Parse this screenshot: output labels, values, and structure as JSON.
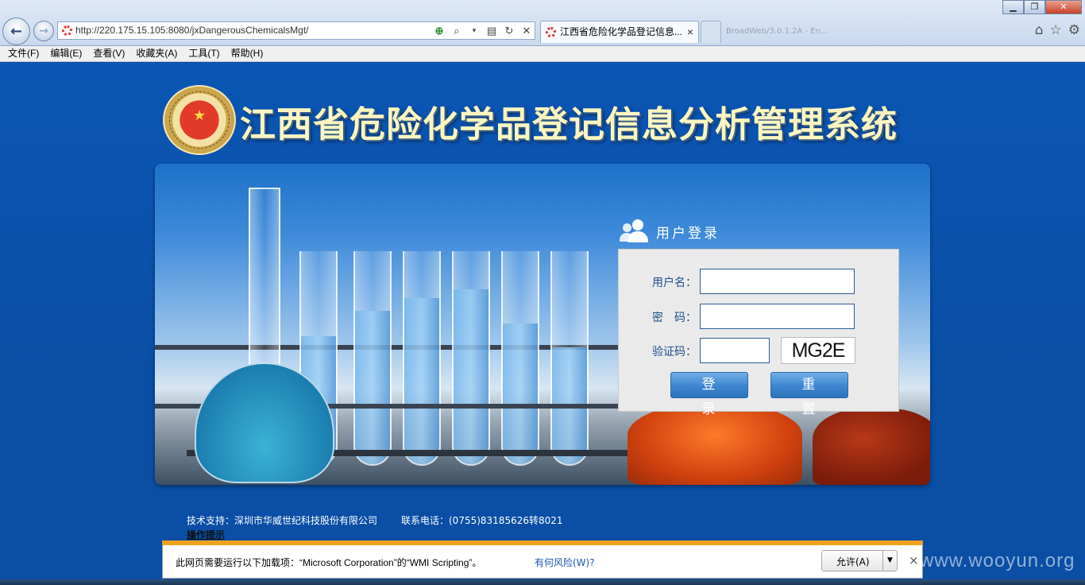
{
  "browser": {
    "address_url": "http://220.175.15.105:8080/jxDangerousChemicalsMgt/",
    "tab_title": "江西省危险化学品登记信息...",
    "tab_close": "×",
    "bg_tab_text": "BroadWeb/3.0.1.2A - En...",
    "window_controls": {
      "minimize": "▁",
      "maximize": "❐",
      "close": "✕"
    }
  },
  "menu": {
    "items": [
      {
        "label": "文件(F)"
      },
      {
        "label": "编辑(E)"
      },
      {
        "label": "查看(V)"
      },
      {
        "label": "收藏夹(A)"
      },
      {
        "label": "工具(T)"
      },
      {
        "label": "帮助(H)"
      }
    ]
  },
  "header": {
    "system_title": "江西省危险化学品登记信息分析管理系统"
  },
  "login": {
    "heading": "用户登录",
    "username_label": "用户名：",
    "password_label": "密　码：",
    "captcha_label": "验证码：",
    "username_value": "",
    "password_value": "",
    "captcha_value": "",
    "captcha_image_text": "MG2E",
    "login_button": "登 录",
    "reset_button": "重 置"
  },
  "footer": {
    "support": "技术支持：深圳市华威世纪科技股份有限公司",
    "phone": "联系电话：(0755)83185626转8021",
    "tips": "操作提示"
  },
  "infobar": {
    "message": "此网页需要运行以下加载项：“Microsoft Corporation”的“WMI Scripting”。",
    "risk_link": "有何风险(W)?",
    "allow_button": "允许(A)",
    "close": "×"
  },
  "watermark": "www.wooyun.org",
  "colors": {
    "page_bg": "#0a4ea5",
    "title_text": "#fbf6bf",
    "button": "#3d86cf",
    "infobar_accent": "#f0a21f"
  }
}
